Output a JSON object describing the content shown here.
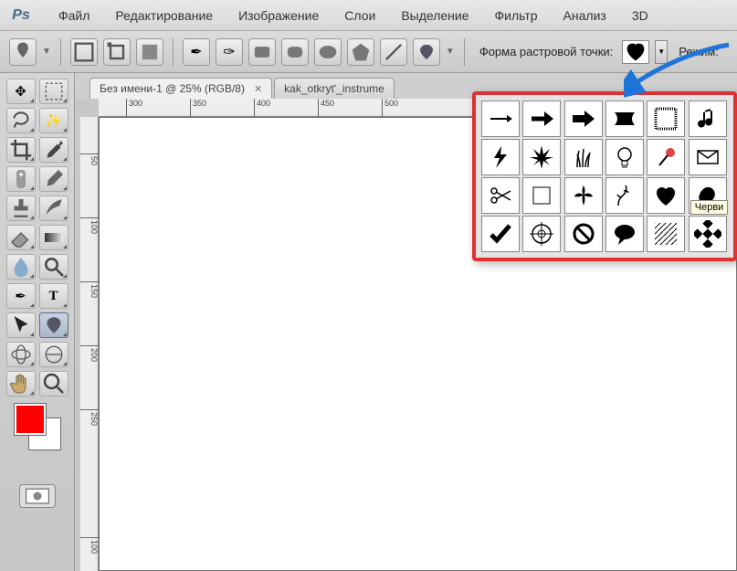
{
  "app": {
    "logo": "Ps"
  },
  "menu": [
    "Файл",
    "Редактирование",
    "Изображение",
    "Слои",
    "Выделение",
    "Фильтр",
    "Анализ",
    "3D"
  ],
  "options": {
    "shape_label": "Форма растровой точки:",
    "mode_label": "Режим:"
  },
  "tabs": [
    {
      "label": "Без имени-1 @ 25% (RGB/8)",
      "active": true
    },
    {
      "label": "kak_otkryt'_instrume",
      "active": false
    }
  ],
  "ruler_h": [
    "300",
    "350",
    "400",
    "450",
    "500"
  ],
  "ruler_v": [
    "50",
    "100",
    "150",
    "200",
    "250",
    "100"
  ],
  "colors": {
    "fg": "#ff0000",
    "bg": "#ffffff"
  },
  "shapes_tooltip": "Черви",
  "shapes": [
    "arrow-thin",
    "arrow-bold",
    "arrow-block",
    "bowtie",
    "frame",
    "note",
    "lightning",
    "burst",
    "grass",
    "bulb",
    "pin",
    "envelope",
    "scissors",
    "rect-outline",
    "fleur",
    "vine",
    "heart",
    "blob",
    "check",
    "crosshair",
    "no",
    "speech",
    "hatch",
    "checker"
  ]
}
